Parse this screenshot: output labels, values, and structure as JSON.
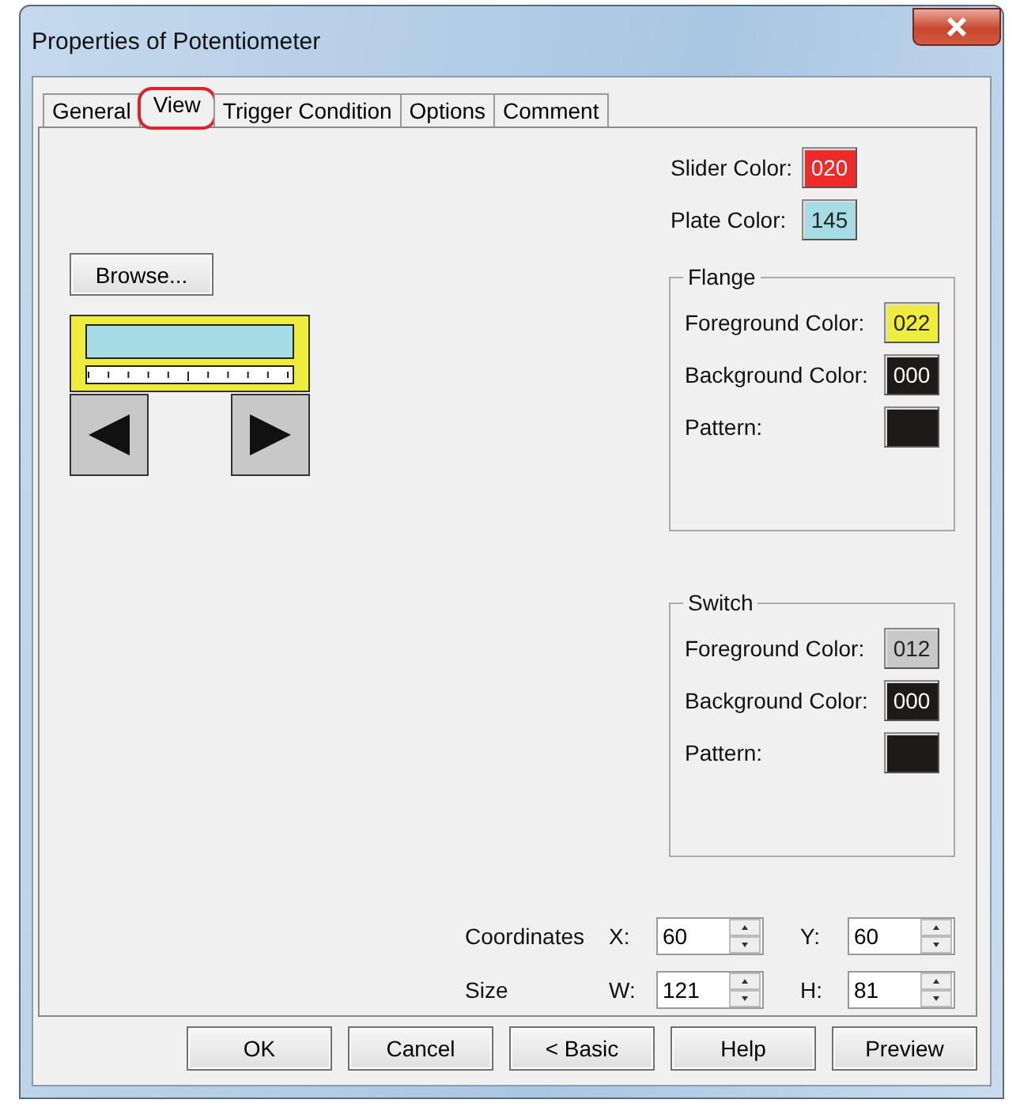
{
  "window": {
    "title": "Properties of Potentiometer"
  },
  "tabs": [
    {
      "label": "General",
      "selected": false,
      "highlighted": false
    },
    {
      "label": "View",
      "selected": true,
      "highlighted": true
    },
    {
      "label": "Trigger Condition",
      "selected": false,
      "highlighted": false
    },
    {
      "label": "Options",
      "selected": false,
      "highlighted": false
    },
    {
      "label": "Comment",
      "selected": false,
      "highlighted": false
    }
  ],
  "browse_button": "Browse...",
  "colors": [
    {
      "label": "Slider Color:",
      "value": "020",
      "color": "#ee2a2a"
    },
    {
      "label": "Plate Color:",
      "value": "145",
      "color": "#a6dde4"
    }
  ],
  "groups": [
    {
      "title": "Flange",
      "rows": [
        {
          "label": "Foreground Color:",
          "value": "022",
          "color": "#eeec3c"
        },
        {
          "label": "Background Color:",
          "value": "000",
          "color": "#1e1a1a"
        },
        {
          "label": "Pattern:",
          "color": "#1e1a1a"
        }
      ]
    },
    {
      "title": "Switch",
      "rows": [
        {
          "label": "Foreground Color:",
          "value": "012",
          "color": "#c8c8c8"
        },
        {
          "label": "Background Color:",
          "value": "000",
          "color": "#1e1a1a"
        },
        {
          "label": "Pattern:",
          "color": "#1e1a1a"
        }
      ]
    }
  ],
  "position_rows": [
    {
      "label": "Coordinates",
      "fields": [
        {
          "label": "X:",
          "value": "60"
        },
        {
          "label": "Y:",
          "value": "60"
        }
      ]
    },
    {
      "label": "Size",
      "fields": [
        {
          "label": "W:",
          "value": "121"
        },
        {
          "label": "H:",
          "value": "81"
        }
      ]
    }
  ],
  "buttons": [
    "OK",
    "Cancel",
    "< Basic",
    "Help",
    "Preview"
  ]
}
